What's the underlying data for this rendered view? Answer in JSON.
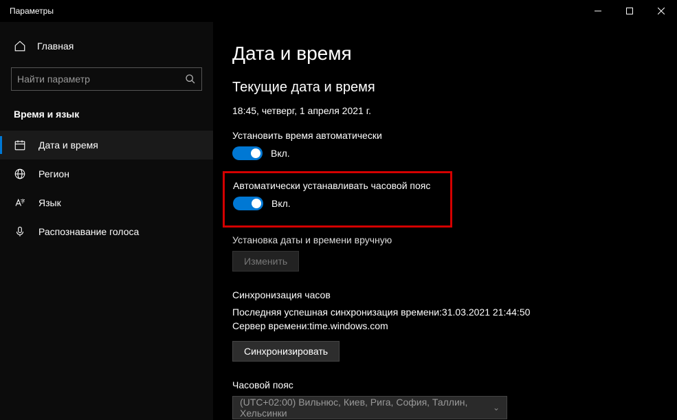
{
  "titlebar": {
    "title": "Параметры"
  },
  "sidebar": {
    "home_label": "Главная",
    "search_placeholder": "Найти параметр",
    "category_label": "Время и язык",
    "items": [
      {
        "label": "Дата и время"
      },
      {
        "label": "Регион"
      },
      {
        "label": "Язык"
      },
      {
        "label": "Распознавание голоса"
      }
    ]
  },
  "content": {
    "page_title": "Дата и время",
    "current_section_title": "Текущие дата и время",
    "current_datetime": "18:45, четверг, 1 апреля 2021 г.",
    "auto_time_label": "Установить время автоматически",
    "auto_time_state": "Вкл.",
    "auto_tz_label": "Автоматически устанавливать часовой пояс",
    "auto_tz_state": "Вкл.",
    "manual_label": "Установка даты и времени вручную",
    "manual_button": "Изменить",
    "sync_title": "Синхронизация часов",
    "sync_last": "Последняя успешная синхронизация времени:31.03.2021 21:44:50",
    "sync_server": "Сервер времени:time.windows.com",
    "sync_button": "Синхронизировать",
    "tz_label": "Часовой пояс",
    "tz_value": "(UTC+02:00) Вильнюс, Киев, Рига, София, Таллин, Хельсинки"
  }
}
